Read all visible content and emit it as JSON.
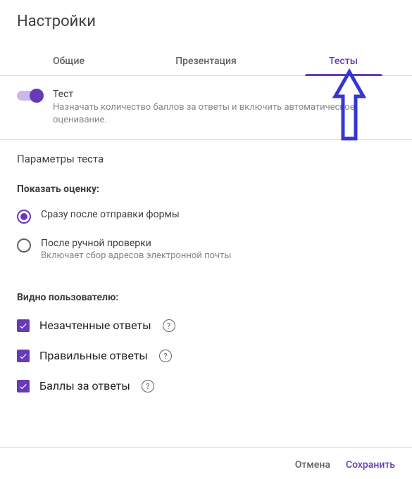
{
  "header": {
    "title": "Настройки"
  },
  "tabs": [
    {
      "label": "Общие",
      "active": false
    },
    {
      "label": "Презентация",
      "active": false
    },
    {
      "label": "Тесты",
      "active": true
    }
  ],
  "quiz_toggle": {
    "title": "Тест",
    "description": "Назначать количество баллов за ответы и включить автоматическое оценивание.",
    "enabled": true
  },
  "params_header": "Параметры теста",
  "release_grade": {
    "header": "Показать оценку:",
    "options": [
      {
        "label": "Сразу после отправки формы",
        "selected": true
      },
      {
        "label": "После ручной проверки",
        "description": "Включает сбор адресов электронной почты",
        "selected": false
      }
    ]
  },
  "respondent_see": {
    "header": "Видно пользователю:",
    "options": [
      {
        "label": "Незачтенные ответы",
        "checked": true
      },
      {
        "label": "Правильные ответы",
        "checked": true
      },
      {
        "label": "Баллы за ответы",
        "checked": true
      }
    ]
  },
  "footer": {
    "cancel": "Отмена",
    "save": "Сохранить"
  },
  "colors": {
    "accent": "#673ab7"
  }
}
